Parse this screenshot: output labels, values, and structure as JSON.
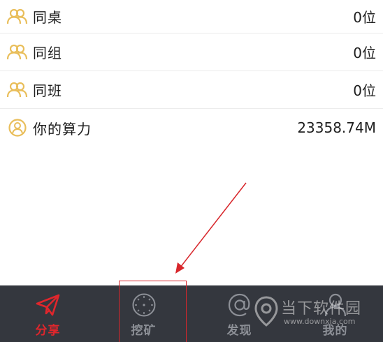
{
  "colors": {
    "accent_gold": "#e9be5a",
    "active_red": "#e0262c",
    "tabbar_bg": "#34373e",
    "tab_inactive": "#8d9097",
    "annotation_red": "#d8262b"
  },
  "rows": [
    {
      "icon": "group-users-icon",
      "label": "同桌",
      "value": "0位"
    },
    {
      "icon": "group-users-icon",
      "label": "同组",
      "value": "0位"
    },
    {
      "icon": "group-users-icon",
      "label": "同班",
      "value": "0位"
    },
    {
      "icon": "user-circle-icon",
      "label": "你的算力",
      "value": "23358.74M"
    }
  ],
  "tabs": [
    {
      "icon": "paper-plane-icon",
      "label": "分享",
      "active": true
    },
    {
      "icon": "dial-icon",
      "label": "挖矿",
      "active": false
    },
    {
      "icon": "at-icon",
      "label": "发现",
      "active": false
    },
    {
      "icon": "person-icon",
      "label": "我的",
      "active": false
    }
  ],
  "watermark": {
    "title": "当下软件园",
    "url": "www.downxia.com"
  }
}
